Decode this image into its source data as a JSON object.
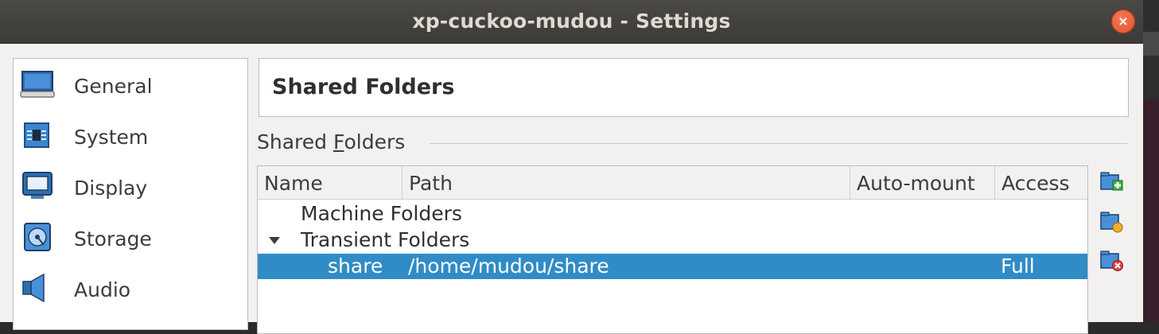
{
  "window": {
    "title": "xp-cuckoo-mudou - Settings",
    "close_symbol": "×"
  },
  "sidebar": {
    "items": [
      {
        "label": "General",
        "icon": "general-icon"
      },
      {
        "label": "System",
        "icon": "system-icon"
      },
      {
        "label": "Display",
        "icon": "display-icon"
      },
      {
        "label": "Storage",
        "icon": "storage-icon"
      },
      {
        "label": "Audio",
        "icon": "audio-icon"
      }
    ]
  },
  "page": {
    "title": "Shared Folders",
    "group_label_prefix": "Shared ",
    "group_label_mnemonic": "F",
    "group_label_rest": "olders"
  },
  "table": {
    "columns": [
      "Name",
      "Path",
      "Auto-mount",
      "Access"
    ],
    "groups": [
      {
        "label": "Machine Folders",
        "expanded": false
      },
      {
        "label": "Transient Folders",
        "expanded": true
      }
    ],
    "rows": [
      {
        "name": "share",
        "path": "/home/mudou/share",
        "auto_mount": "",
        "access": "Full",
        "selected": true
      }
    ]
  },
  "actions": [
    {
      "name": "add-shared-folder",
      "icon": "folder-add-icon"
    },
    {
      "name": "edit-shared-folder",
      "icon": "folder-edit-icon"
    },
    {
      "name": "remove-shared-folder",
      "icon": "folder-remove-icon"
    }
  ],
  "colors": {
    "selection": "#308cc6",
    "titlebar": "#3c3b37",
    "close_button": "#e0532a"
  }
}
